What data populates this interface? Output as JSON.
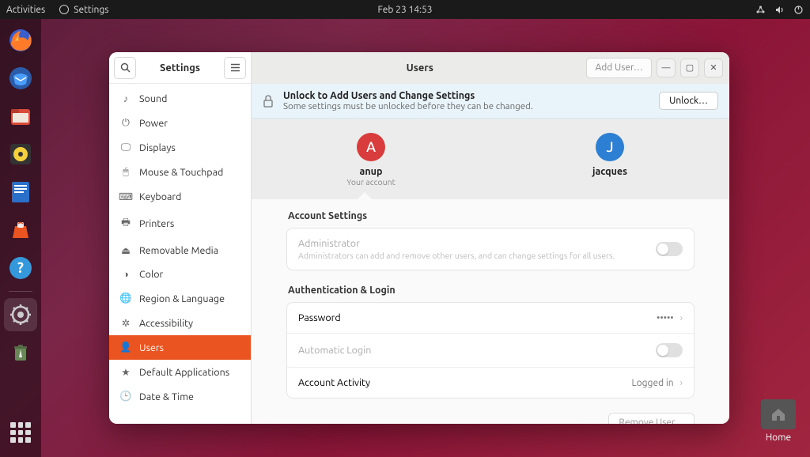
{
  "topbar": {
    "activities": "Activities",
    "app_name": "Settings",
    "datetime": "Feb 23  14:53"
  },
  "desktop": {
    "home_label": "Home"
  },
  "sidebar": {
    "title": "Settings",
    "items": [
      {
        "icon": "♪",
        "label": "Sound"
      },
      {
        "icon": "⏻",
        "label": "Power"
      },
      {
        "icon": "🖵",
        "label": "Displays"
      },
      {
        "icon": "🖱",
        "label": "Mouse & Touchpad"
      },
      {
        "icon": "⌨",
        "label": "Keyboard"
      },
      {
        "icon": "🖶",
        "label": "Printers"
      },
      {
        "icon": "⏏",
        "label": "Removable Media"
      },
      {
        "icon": "◑",
        "label": "Color"
      },
      {
        "icon": "🌐",
        "label": "Region & Language"
      },
      {
        "icon": "✲",
        "label": "Accessibility"
      },
      {
        "icon": "👤",
        "label": "Users"
      },
      {
        "icon": "★",
        "label": "Default Applications"
      },
      {
        "icon": "🕒",
        "label": "Date & Time"
      }
    ],
    "selected_index": 10
  },
  "main": {
    "title": "Users",
    "add_user": "Add User…",
    "banner": {
      "title": "Unlock to Add Users and Change Settings",
      "subtitle": "Some settings must be unlocked before they can be changed.",
      "unlock": "Unlock…"
    },
    "users": [
      {
        "initial": "A",
        "name": "anup",
        "sub": "Your account",
        "color": "red"
      },
      {
        "initial": "J",
        "name": "jacques",
        "sub": "",
        "color": "blue"
      }
    ],
    "sections": {
      "account_settings": "Account Settings",
      "admin_label": "Administrator",
      "admin_sub": "Administrators can add and remove other users, and can change settings for all users.",
      "auth_login": "Authentication & Login",
      "password_label": "Password",
      "password_value": "•••••",
      "auto_login": "Automatic Login",
      "activity_label": "Account Activity",
      "activity_value": "Logged in"
    },
    "remove_user": "Remove User…"
  }
}
